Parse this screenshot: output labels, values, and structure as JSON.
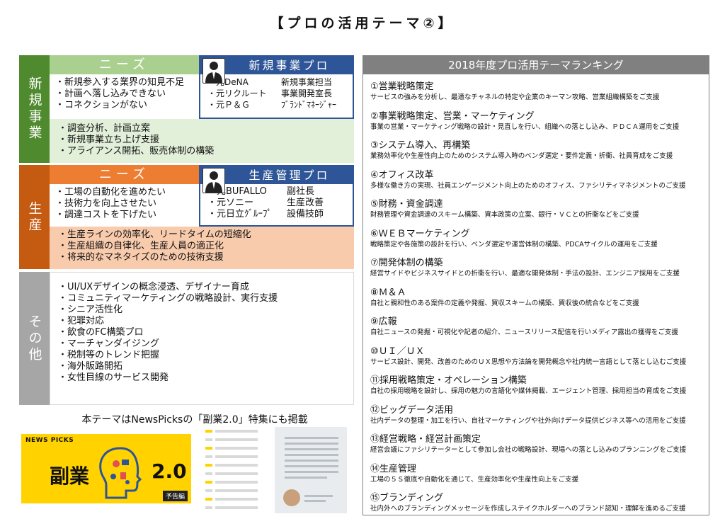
{
  "title": "【プロの活用テーマ②】",
  "colors": {
    "green_dark": "#4f8a2e",
    "green_light": "#a9d08e",
    "green_pale": "#e2efd9",
    "orange_dark": "#c55a11",
    "orange_light": "#ed7d31",
    "orange_pale": "#f8cbad",
    "gray_dark": "#a6a6a6",
    "gray_light": "#d9d9d9",
    "blue": "#2e5597",
    "rank_header": "#808080"
  },
  "sections": [
    {
      "label": "新規事業",
      "needs_header": "ニーズ",
      "needs": [
        "・新規参入する業界の知見不足",
        "・計画へ落し込みできない",
        "・コネクションがない"
      ],
      "pro_header": "新規事業プロ",
      "pros": [
        {
          "org": "・元DeNA",
          "role": "新規事業担当"
        },
        {
          "org": "・元リクルート",
          "role": "事業開発室長"
        },
        {
          "org": "・元Ｐ＆Ｇ",
          "role": "ﾌﾞﾗﾝﾄﾞﾏﾈｰｼﾞｬｰ"
        }
      ],
      "themes": [
        "・調査分析、計画立案",
        "・新規事業立ち上げ支援",
        "・アライアンス開拓、販売体制の構築"
      ]
    },
    {
      "label": "生産",
      "needs_header": "ニーズ",
      "needs": [
        "・工場の自動化を進めたい",
        "・技術力を向上させたい",
        "・調達コストを下げたい"
      ],
      "pro_header": "生産管理プロ",
      "pros": [
        {
          "org": "・元BUFALLO",
          "role": "副社長"
        },
        {
          "org": "・元ソニー",
          "role": "生産改善"
        },
        {
          "org": "・元日立ｸﾞﾙｰﾌﾟ",
          "role": "設備技師"
        }
      ],
      "themes": [
        "・生産ラインの効率化、リードタイムの短縮化",
        "・生産組織の自律化、生産人員の適正化",
        "・将来的なマネタイズのための技術支援"
      ]
    },
    {
      "label": "その他",
      "themes": [
        "・UI/UXデザインの概念浸透、デザイナー育成",
        "・コミュニティマーケティングの戦略設計、実行支援",
        "・シニア活性化",
        "・犯罪対応",
        "・飲食のFC構築プロ",
        "・マーチャンダイジング",
        "・税制等のトレンド把握",
        "・海外販路開拓",
        "・女性目線のサービス開発"
      ]
    }
  ],
  "newspicks": {
    "caption": "本テーマはNewsPicksの「副業2.0」特集にも掲載",
    "brand": "NEWS PICKS",
    "main_word": "副業",
    "version": "2.0",
    "tag": "予告編"
  },
  "ranking": {
    "header": "2018年度プロ活用テーマランキング",
    "items": [
      {
        "title": "①営業戦略策定",
        "desc": "サービスの強みを分析し、最適なチャネルの特定や企業のキーマン攻略、営業組織構築をご支援"
      },
      {
        "title": "②事業戦略策定、営業・マーケティング",
        "desc": "事業の営業・マーケティング戦略の設計・見直しを行い、組織への落とし込み、ＰＤＣＡ運用をご支援"
      },
      {
        "title": "③システム導入、再構築",
        "desc": "業務効率化や生産性向上のためのシステム導入時のベンダ選定・要件定義・折衝、社員育成をご支援"
      },
      {
        "title": "④オフィス改革",
        "desc": "多様な働き方の実現、社員エンゲージメント向上のためのオフィス、ファシリティマネジメントのご支援"
      },
      {
        "title": "⑤財務・資金調達",
        "desc": "財務管理や資金調達のスキーム構築、資本政策の立案、銀行・ＶＣとの折衝などをご支援"
      },
      {
        "title": "⑥ＷＥＢマーケティング",
        "desc": "戦略策定や各施策の設計を行い、ベンダ選定や運営体制の構築、PDCAサイクルの運用をご支援"
      },
      {
        "title": "⑦開発体制の構築",
        "desc": "経営サイドやビジネスサイドとの折衝を行い、最適な開発体制・手法の設計、エンジニア採用をご支援"
      },
      {
        "title": "⑧Ｍ＆Ａ",
        "desc": "自社と親和性のある案件の定義や発掘、買収スキームの構築、買収後の統合などをご支援"
      },
      {
        "title": "⑨広報",
        "desc": "自社ニュースの発掘・可視化や記者の紹介、ニュースリリース配信を行いメディア露出の獲得をご支援"
      },
      {
        "title": "⑩ＵＩ／ＵＸ",
        "desc": "サービス設計、開発、改善のためのＵＸ思想や方法論を開発概念や社内統一言語として落とし込むご支援"
      },
      {
        "title": "⑪採用戦略策定・オペレーション構築",
        "desc": "自社の採用戦略を設計し、採用の魅力の言語化や媒体掲載、エージェント管理、採用担当の育成をご支援"
      },
      {
        "title": "⑫ビッグデータ活用",
        "desc": "社内データの整理・加工を行い、自社マーケティングや社外向けデータ提供ビジネス等への活用をご支援"
      },
      {
        "title": "⑬経営戦略・経営計画策定",
        "desc": "経営会議にファシリテーターとして参加し会社の戦略設計、現場への落とし込みのプランニングをご支援"
      },
      {
        "title": "⑭生産管理",
        "desc": "工場の５Ｓ徹底や自動化を通じて、生産効率化や生産性向上をご支援"
      },
      {
        "title": "⑮ブランディング",
        "desc": "社内外へのブランディングメッセージを作成しステイクホルダーへのブランド認知・理解を進めるご支援"
      }
    ]
  }
}
